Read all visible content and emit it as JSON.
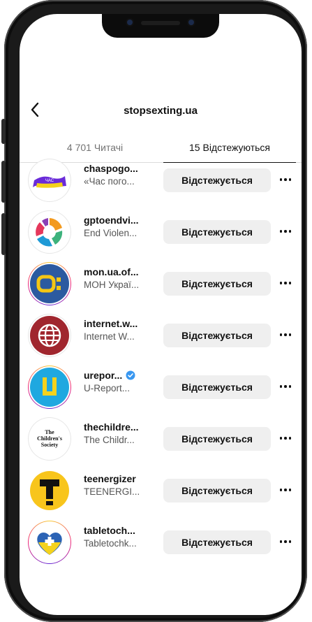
{
  "header": {
    "title": "stopsexting.ua"
  },
  "tabs": {
    "followers": "4 701 Читачі",
    "following": "15 Відстежуються"
  },
  "accounts": [
    {
      "username": "chaspogo...",
      "full_name": "«Час пого...",
      "button": "Відстежується",
      "avatar": "chas-pogovoryty-logo",
      "verified": false
    },
    {
      "username": "gptoendvi...",
      "full_name": "End Violen...",
      "button": "Відстежується",
      "avatar": "end-violence-logo",
      "verified": false
    },
    {
      "username": "mon.ua.of...",
      "full_name": "МОН Украї...",
      "button": "Відстежується",
      "avatar": "mon-logo",
      "verified": false
    },
    {
      "username": "internet.w...",
      "full_name": "Internet W...",
      "button": "Відстежується",
      "avatar": "globe-logo",
      "verified": false
    },
    {
      "username": "urepor...",
      "full_name": "U-Report...",
      "button": "Відстежується",
      "avatar": "ureport-logo",
      "verified": true
    },
    {
      "username": "thechildre...",
      "full_name": "The Childr...",
      "button": "Відстежується",
      "avatar": "childrens-society-logo",
      "logo_text": [
        "The",
        "Children's",
        "Society"
      ],
      "verified": false
    },
    {
      "username": "teenergizer",
      "full_name": "TEENERGI...",
      "button": "Відстежується",
      "avatar": "teenergizer-logo",
      "verified": false
    },
    {
      "username": "tabletoch...",
      "full_name": "Tabletochk...",
      "button": "Відстежується",
      "avatar": "tabletochki-logo",
      "verified": false
    }
  ],
  "colors": {
    "button_bg": "#efefef",
    "verified": "#3897f0",
    "tab_inactive": "#737373"
  }
}
